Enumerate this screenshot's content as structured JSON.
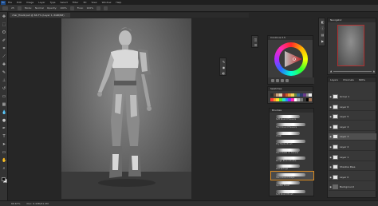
{
  "app": {
    "logo": "Ps",
    "menu": [
      "File",
      "Edit",
      "Image",
      "Layer",
      "Type",
      "Select",
      "Filter",
      "3D",
      "View",
      "Window",
      "Help"
    ]
  },
  "options_bar": {
    "size_value": "25",
    "mode_label": "Mode:",
    "mode_value": "Normal",
    "opacity_label": "Opacity:",
    "opacity_value": "100%",
    "flow_label": "Flow:",
    "flow_value": "100%"
  },
  "document": {
    "tab_title": "char_final2.psd @ 66.7% (Layer 1, RGB/8#)"
  },
  "status_bar": {
    "zoom": "66.67%",
    "doc_info": "Doc: 6.43M/41.2M"
  },
  "toolbar": {
    "icons": [
      "move-icon",
      "marquee-icon",
      "lasso-icon",
      "quick-select-icon",
      "crop-icon",
      "eyedropper-icon",
      "healing-icon",
      "brush-icon",
      "stamp-icon",
      "history-brush-icon",
      "eraser-icon",
      "gradient-icon",
      "blur-icon",
      "dodge-icon",
      "pen-icon",
      "type-icon",
      "path-select-icon",
      "shape-icon",
      "hand-icon",
      "zoom-icon"
    ],
    "fg_color": "#0f0f0f",
    "bg_color": "#f2f2f2"
  },
  "panels": {
    "color_title": "Coolorus 2.5",
    "swatches_title": "Swatches",
    "brushes_title": "Brushes",
    "navigator_title": "Navigator",
    "layers_tabs": [
      "Layers",
      "Channels",
      "Paths"
    ]
  },
  "swatches": {
    "row1": [
      "#2a2a2a",
      "#6b4a3a",
      "#c9a27a",
      "#e8d2b0",
      "#8a3030",
      "#d05a2a",
      "#e8a23a",
      "#f2d35a",
      "#6a8a3a",
      "#3a6a8a",
      "#2a3a6a",
      "#6a3a8a",
      "#8a8a8a",
      "#f0f0f0"
    ],
    "row2": [
      "#ff3b3b",
      "#ff9a2a",
      "#ffe12a",
      "#5ae12a",
      "#2ae1c8",
      "#2a8aff",
      "#8a2aff",
      "#ff2ab0",
      "#ffffff",
      "#bbbbbb",
      "#777777",
      "#333333",
      "#000000",
      "#aa7755"
    ]
  },
  "brushes": [
    {
      "name": "Soft Round Pressure",
      "selected": false
    },
    {
      "name": "Hard Round Pressure",
      "selected": false
    },
    {
      "name": "Chalk",
      "selected": false
    },
    {
      "name": "Dry Media Brush",
      "selected": false
    },
    {
      "name": "Hard Pastel on Canvas",
      "selected": false
    },
    {
      "name": "Rough Round Bristle",
      "selected": false
    },
    {
      "name": "Wet Sponge",
      "selected": false
    },
    {
      "name": "Hard Round Shape",
      "selected": true
    },
    {
      "name": "Spatter Brush",
      "selected": false
    },
    {
      "name": "Soft Round Brush",
      "selected": false
    }
  ],
  "layers": [
    {
      "name": "Group 1",
      "selected": false
    },
    {
      "name": "Layer 6",
      "selected": false
    },
    {
      "name": "Layer 5",
      "selected": false
    },
    {
      "name": "Layer 4",
      "selected": false
    },
    {
      "name": "Layer 3",
      "selected": true
    },
    {
      "name": "Layer 2",
      "selected": false
    },
    {
      "name": "Layer 1",
      "selected": false
    },
    {
      "name": "Shadow Pass",
      "selected": false
    },
    {
      "name": "Layer 0",
      "selected": false
    },
    {
      "name": "Background",
      "selected": false
    }
  ]
}
